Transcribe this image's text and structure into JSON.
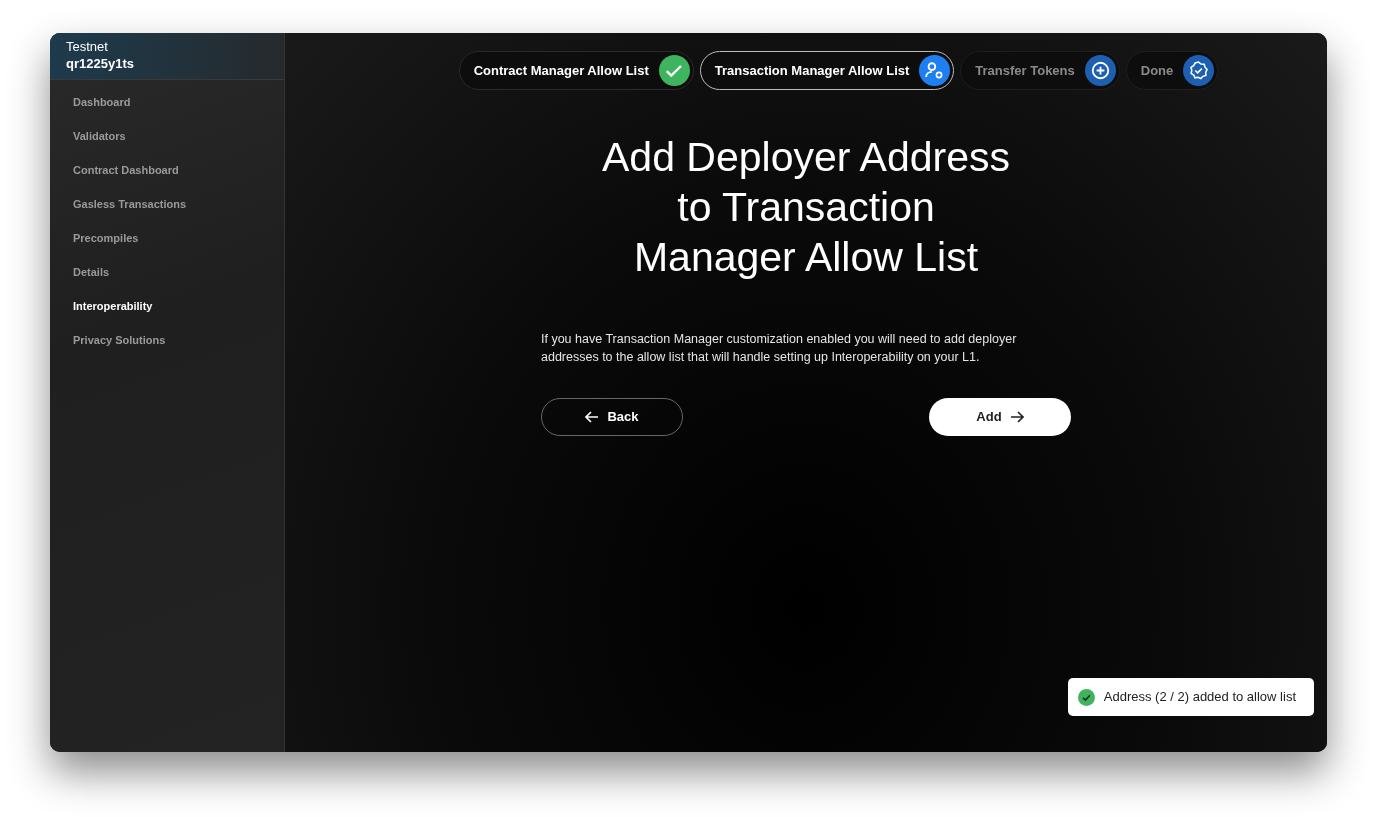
{
  "sidebar": {
    "network": "Testnet",
    "chain": "qr1225y1ts",
    "items": [
      {
        "label": "Dashboard",
        "selected": false
      },
      {
        "label": "Validators",
        "selected": false
      },
      {
        "label": "Contract Dashboard",
        "selected": false
      },
      {
        "label": "Gasless Transactions",
        "selected": false
      },
      {
        "label": "Precompiles",
        "selected": false
      },
      {
        "label": "Details",
        "selected": false
      },
      {
        "label": "Interoperability",
        "selected": true
      },
      {
        "label": "Privacy Solutions",
        "selected": false
      }
    ]
  },
  "steps": [
    {
      "label": "Contract Manager Allow List",
      "completed": true,
      "selected": false
    },
    {
      "label": "Transaction Manager Allow List",
      "completed": false,
      "selected": true
    },
    {
      "label": "Transfer Tokens",
      "completed": false,
      "selected": false
    },
    {
      "label": "Done",
      "completed": false,
      "selected": false
    }
  ],
  "title": "Add Deployer Address to Transaction Manager Allow List",
  "description": "If you have Transaction Manager customization enabled you will need to add deployer addresses to the allow list that will handle setting up Interoperability on your L1.",
  "buttons": {
    "back": "Back",
    "next": "Add"
  },
  "toast": {
    "message": "Address (2 / 2) added to allow list"
  }
}
